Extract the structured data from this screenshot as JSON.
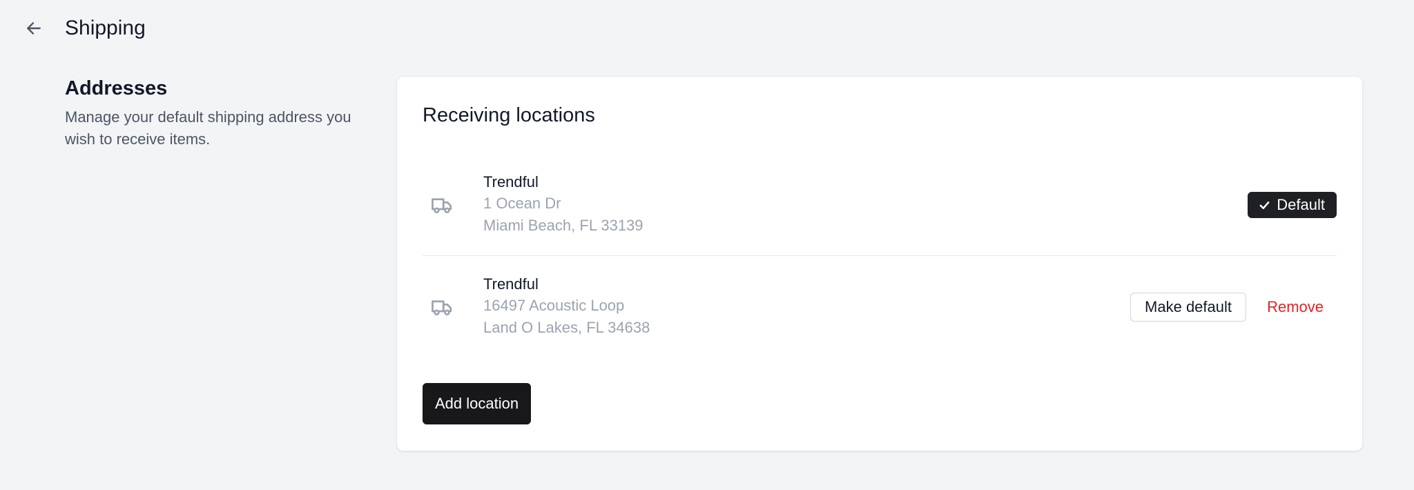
{
  "header": {
    "title": "Shipping",
    "back_icon": "arrow-left-icon"
  },
  "section": {
    "heading": "Addresses",
    "description": "Manage your default shipping address you wish to receive items."
  },
  "card": {
    "title": "Receiving locations",
    "locations": [
      {
        "name": "Trendful",
        "address_line_1": "1 Ocean Dr",
        "address_line_2": "Miami Beach, FL 33139",
        "is_default": true,
        "default_label": "Default",
        "icon": "truck-icon"
      },
      {
        "name": "Trendful",
        "address_line_1": "16497 Acoustic Loop",
        "address_line_2": "Land O Lakes, FL 34638",
        "is_default": false,
        "make_default_label": "Make default",
        "remove_label": "Remove",
        "icon": "truck-icon"
      }
    ],
    "add_location_label": "Add location"
  },
  "colors": {
    "page_background": "#f3f4f6",
    "card_background": "#ffffff",
    "primary_button": "#18181b",
    "danger_text": "#dc2626",
    "muted_text": "#9ca3af"
  }
}
